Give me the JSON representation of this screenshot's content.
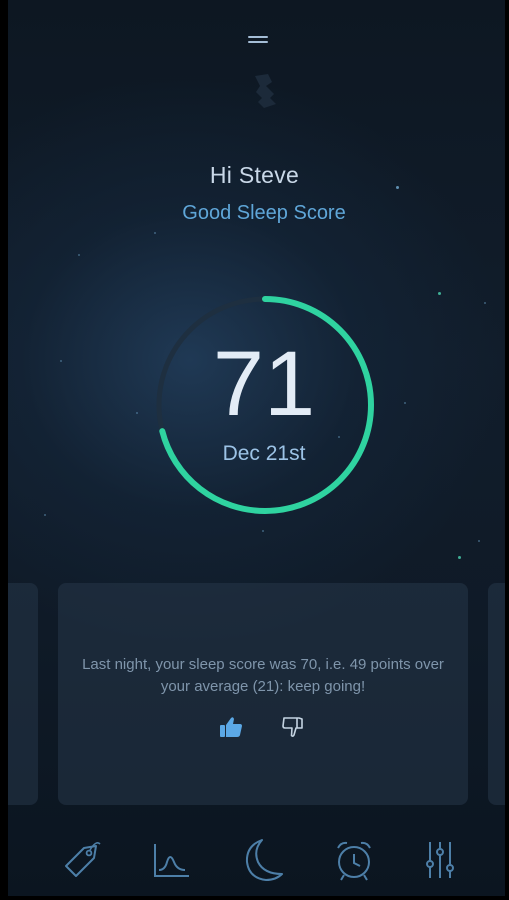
{
  "header": {
    "menu_icon": "hamburger-icon",
    "logo_icon": "logo-icon"
  },
  "greeting": {
    "text": "Hi Steve",
    "score_label": "Good Sleep Score"
  },
  "score": {
    "value": "71",
    "date": "Dec 21st",
    "ring_fraction": 0.71,
    "ring_color": "#2fd3a0",
    "track_color": "#1e2f40"
  },
  "card": {
    "message": "Last night, your sleep score was 70, i.e. 49 points over your average (21): keep going!",
    "thumbs_up_icon": "thumbs-up-icon",
    "thumbs_down_icon": "thumbs-down-icon"
  },
  "nav": {
    "items": [
      {
        "icon": "tag-icon"
      },
      {
        "icon": "chart-icon"
      },
      {
        "icon": "moon-icon"
      },
      {
        "icon": "alarm-clock-icon"
      },
      {
        "icon": "sliders-icon"
      }
    ]
  },
  "colors": {
    "accent": "#2fd3a0",
    "highlight": "#5fa6d8",
    "icon": "#4d7fa8",
    "thumb_active": "#5ba8e6"
  }
}
